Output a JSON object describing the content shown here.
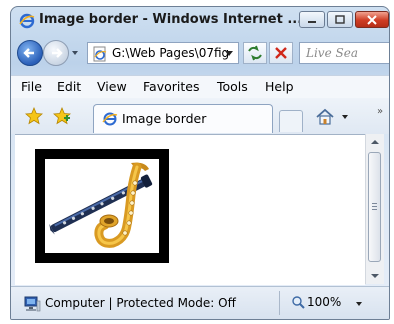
{
  "window": {
    "title": "Image border - Windows Internet ..."
  },
  "address_bar": {
    "url": "G:\\Web Pages\\07fig",
    "search_placeholder": "Live Sea"
  },
  "menu": [
    "File",
    "Edit",
    "View",
    "Favorites",
    "Tools",
    "Help"
  ],
  "tabs": [
    {
      "label": "Image border",
      "icon": "ie-page-icon"
    }
  ],
  "content": {
    "image_alt": "clarinet and saxophone",
    "border_color": "#000000"
  },
  "statusbar": {
    "zone": "Computer | Protected Mode: Off",
    "zoom": "100%"
  },
  "icons": {
    "back": "back-arrow-icon",
    "forward": "forward-arrow-icon",
    "refresh": "refresh-icon",
    "stop": "stop-icon",
    "favorites": "favorites-star-icon",
    "add_favorites": "add-favorites-icon",
    "home": "home-icon",
    "computer": "computer-icon",
    "zoom": "zoom-magnifier-icon"
  },
  "colors": {
    "chrome": "#cfe0f1",
    "close_button": "#cf3d24",
    "back_button": "#2a5fb8"
  }
}
